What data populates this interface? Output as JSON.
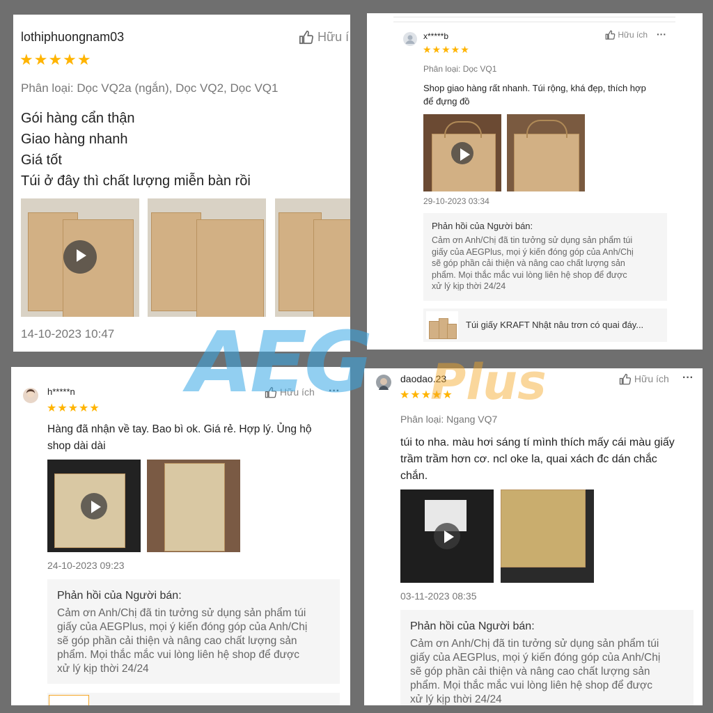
{
  "watermark": {
    "main": "AEG",
    "sub": "Plus",
    "main_color": "#38a8e6",
    "sub_color": "#f5a623"
  },
  "colors": {
    "star": "#ffb400",
    "muted": "#777777"
  },
  "reviews": [
    {
      "username": "lothiphuongnam03",
      "stars": "★★★★★",
      "helpful": "Hữu í",
      "variant": "Phân loại: Dọc VQ2a (ngắn), Dọc VQ2, Dọc VQ1",
      "lines": [
        "Gói hàng cẩn thận",
        "Giao hàng nhanh",
        "Giá tốt",
        "Túi ở đây thì chất lượng miễn bàn rồi"
      ],
      "date": "14-10-2023 10:47"
    },
    {
      "username": "x*****b",
      "stars": "★★★★★",
      "helpful": "Hữu ích",
      "more": "···",
      "variant": "Phân loại: Dọc VQ1",
      "lines": [
        "Shop giao hàng rất nhanh. Túi rộng, khá đẹp, thích hợp",
        "để đựng đồ"
      ],
      "date": "29-10-2023 03:34",
      "reply_title": "Phản hồi của Người bán:",
      "reply_lines": [
        "Cảm ơn Anh/Chị đã tin tưởng sử dụng sản phẩm túi",
        "giấy của AEGPlus, mọi ý kiến đóng góp của Anh/Chị",
        "sẽ góp phần cải thiện và nâng cao chất lượng sản",
        "phẩm. Mọi thắc mắc vui lòng liên hệ shop để được",
        "xử lý kịp thời 24/24"
      ],
      "product": "Túi giấy KRAFT Nhật nâu trơn có quai đáy..."
    },
    {
      "username": "h*****n",
      "stars": "★★★★★",
      "helpful": "Hữu ích",
      "more": "···",
      "lines": [
        "Hàng đã nhận về tay. Bao bì ok. Giá rẻ. Hợp lý. Ủng hộ",
        "shop dài dài"
      ],
      "date": "24-10-2023 09:23",
      "reply_title": "Phản hồi của Người bán:",
      "reply_lines": [
        "Cảm ơn Anh/Chị đã tin tưởng sử dụng sản phẩm túi",
        "giấy của AEGPlus, mọi ý kiến đóng góp của Anh/Chị",
        "sẽ góp phần cải thiện và nâng cao chất lượng sản",
        "phẩm. Mọi thắc mắc vui lòng liên hệ shop để được",
        "xử lý kịp thời 24/24"
      ]
    },
    {
      "username": "daodao.23",
      "stars": "★★★★★",
      "helpful": "Hữu ích",
      "more": "···",
      "variant": "Phân loại: Ngang VQ7",
      "lines": [
        "túi to nha. màu hơi sáng tí mình thích mấy cái màu giấy",
        "trầm trầm hơn cơ. ncl oke la, quai xách đc dán chắc",
        "chắn."
      ],
      "date": "03-11-2023 08:35",
      "reply_title": "Phản hồi của Người bán:",
      "reply_lines": [
        "Cảm ơn Anh/Chị đã tin tưởng sử dụng sản phẩm túi",
        "giấy của AEGPlus, mọi ý kiến đóng góp của Anh/Chị",
        "sẽ góp phần cải thiện và nâng cao chất lượng sản",
        "phẩm. Mọi thắc mắc vui lòng liên hệ shop để được",
        "xử lý kịp thời 24/24"
      ]
    }
  ]
}
